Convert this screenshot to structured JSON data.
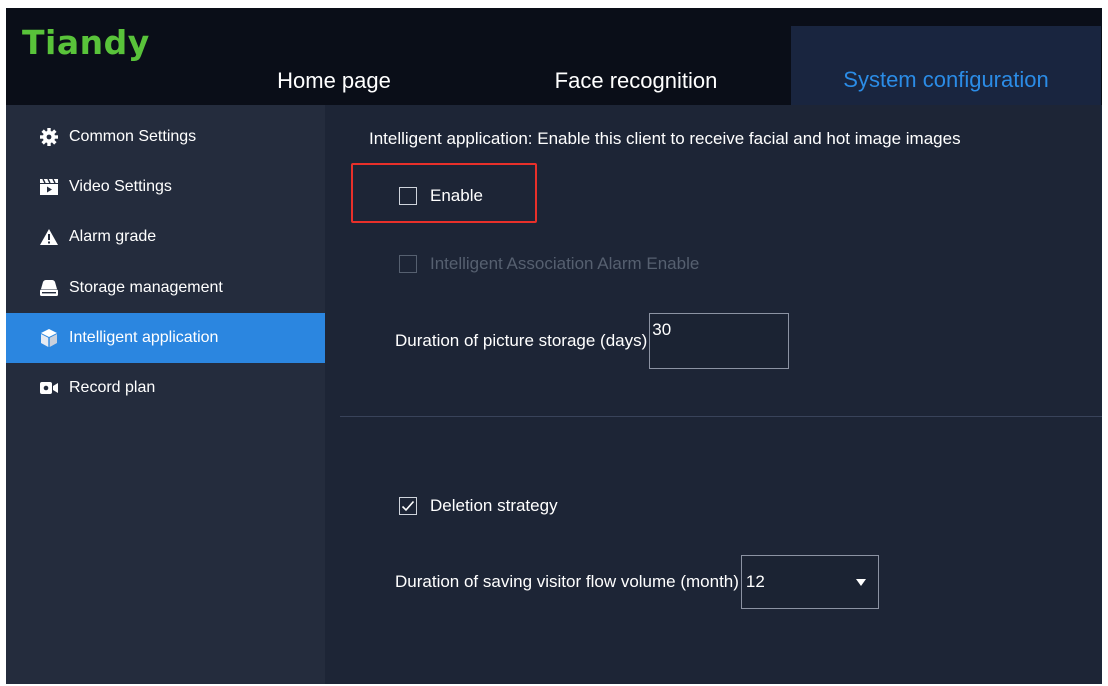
{
  "header": {
    "logo": "Tiandy",
    "tabs": [
      {
        "label": "Home page",
        "active": false
      },
      {
        "label": "Face recognition",
        "active": false
      },
      {
        "label": "System configuration",
        "active": true
      }
    ]
  },
  "sidebar": {
    "items": [
      {
        "label": "Common Settings",
        "icon": "gear-icon",
        "active": false
      },
      {
        "label": "Video Settings",
        "icon": "clapperboard-icon",
        "active": false
      },
      {
        "label": "Alarm grade",
        "icon": "warning-icon",
        "active": false
      },
      {
        "label": "Storage management",
        "icon": "storage-icon",
        "active": false
      },
      {
        "label": "Intelligent application",
        "icon": "cube-icon",
        "active": true
      },
      {
        "label": "Record plan",
        "icon": "camera-icon",
        "active": false
      }
    ]
  },
  "main": {
    "description": "Intelligent application: Enable this client to receive facial and hot image images",
    "enable": {
      "label": "Enable",
      "checked": false
    },
    "association_alarm": {
      "label": "Intelligent Association Alarm Enable",
      "checked": false,
      "disabled": true
    },
    "picture_storage": {
      "label": "Duration of picture storage (days)",
      "value": "30"
    },
    "deletion_strategy": {
      "label": "Deletion strategy",
      "checked": true
    },
    "visitor_flow": {
      "label": "Duration of saving visitor flow volume (month)",
      "value": "12"
    }
  },
  "colors": {
    "brand_green": "#59c33a",
    "accent_blue": "#2b86e0",
    "highlight_red": "#e8302a",
    "header_bg": "#0a0e18",
    "sidebar_bg": "#242c3d",
    "content_bg": "#1d2536"
  }
}
